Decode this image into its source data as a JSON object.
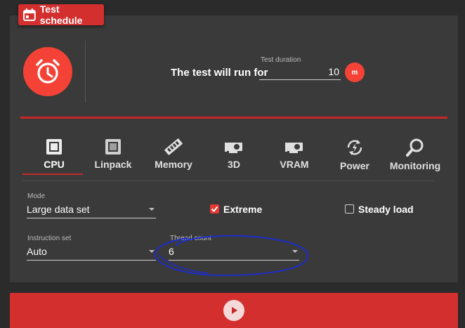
{
  "header": {
    "title": "Test schedule"
  },
  "schedule": {
    "run_text": "The test will run for",
    "duration_label": "Test duration",
    "duration_value": "10",
    "duration_unit": "m"
  },
  "tabs": [
    {
      "label": "CPU",
      "icon": "cpu-chip-icon",
      "active": true
    },
    {
      "label": "Linpack",
      "icon": "chip-outline-icon",
      "active": false
    },
    {
      "label": "Memory",
      "icon": "memory-stick-icon",
      "active": false
    },
    {
      "label": "3D",
      "icon": "graphics-card-icon",
      "active": false
    },
    {
      "label": "VRAM",
      "icon": "graphics-card-icon",
      "active": false
    },
    {
      "label": "Power",
      "icon": "power-cycle-icon",
      "active": false
    },
    {
      "label": "Monitoring",
      "icon": "magnifier-icon",
      "active": false
    }
  ],
  "settings": {
    "mode": {
      "label": "Mode",
      "value": "Large data set"
    },
    "instruction_set": {
      "label": "Instruction set",
      "value": "Auto"
    },
    "thread_count": {
      "label": "Thread count",
      "value": "6"
    },
    "extreme": {
      "label": "Extreme",
      "checked": true
    },
    "steady_load": {
      "label": "Steady load",
      "checked": false
    }
  },
  "colors": {
    "accent": "#f44336",
    "accent_dark": "#d32f2f",
    "panel": "#3a3a3a",
    "background": "#2b2b2b",
    "annotation": "#1a2bd6"
  }
}
